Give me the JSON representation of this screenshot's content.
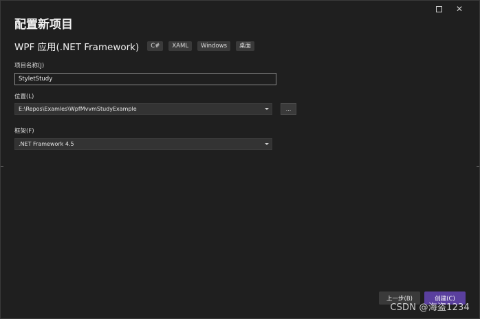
{
  "window": {
    "controls": {
      "maximize_icon": "maximize-icon",
      "close_symbol": "✕"
    }
  },
  "page": {
    "title": "配置新项目"
  },
  "project": {
    "type_name": "WPF 应用(.NET Framework)",
    "tags": [
      "C#",
      "XAML",
      "Windows",
      "桌面"
    ]
  },
  "fields": {
    "name_label": "项目名称(J)",
    "name_value": "StyletStudy",
    "location_label": "位置(L)",
    "location_value": "E:\\Repos\\Examles\\WpfMvvmStudyExample",
    "browse_label": "...",
    "framework_label": "框架(F)",
    "framework_value": ".NET Framework 4.5"
  },
  "footer": {
    "back_label": "上一步(B)",
    "create_label": "创建(C)"
  },
  "watermark": "CSDN @海盗1234",
  "colors": {
    "background": "#1f1f1f",
    "accent": "#5a3f9e",
    "control": "#333333"
  }
}
